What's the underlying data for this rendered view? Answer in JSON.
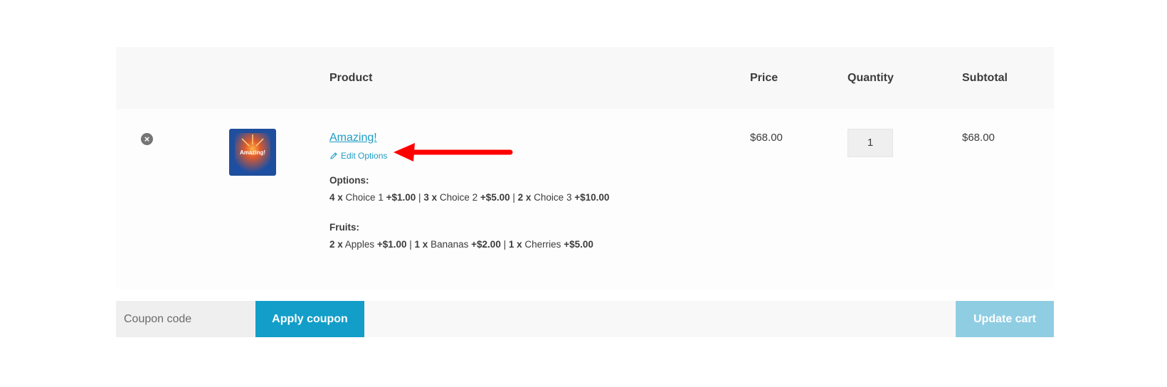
{
  "table": {
    "headers": {
      "product": "Product",
      "price": "Price",
      "quantity": "Quantity",
      "subtotal": "Subtotal"
    }
  },
  "item": {
    "remove_icon": "close-circle-icon",
    "thumbnail_text": "Amazing!",
    "name": "Amazing!",
    "edit_label": "Edit Options",
    "edit_icon": "pencil-icon",
    "price": "$68.00",
    "quantity": "1",
    "subtotal": "$68.00",
    "options": {
      "label": "Options:",
      "entries": [
        {
          "qty": "4 x",
          "name": "Choice 1",
          "price": "+$1.00"
        },
        {
          "qty": "3 x",
          "name": "Choice 2",
          "price": "+$5.00"
        },
        {
          "qty": "2 x",
          "name": "Choice 3",
          "price": "+$10.00"
        }
      ]
    },
    "fruits": {
      "label": "Fruits:",
      "entries": [
        {
          "qty": "2 x",
          "name": "Apples",
          "price": "+$1.00"
        },
        {
          "qty": "1 x",
          "name": "Bananas",
          "price": "+$2.00"
        },
        {
          "qty": "1 x",
          "name": "Cherries",
          "price": "+$5.00"
        }
      ]
    }
  },
  "actions": {
    "coupon_placeholder": "Coupon code",
    "apply_label": "Apply coupon",
    "update_label": "Update cart"
  },
  "colors": {
    "link": "#1e9cc4",
    "apply_button": "#129ec9",
    "update_button": "#8fcde3",
    "annotation_arrow": "#ff0000"
  }
}
